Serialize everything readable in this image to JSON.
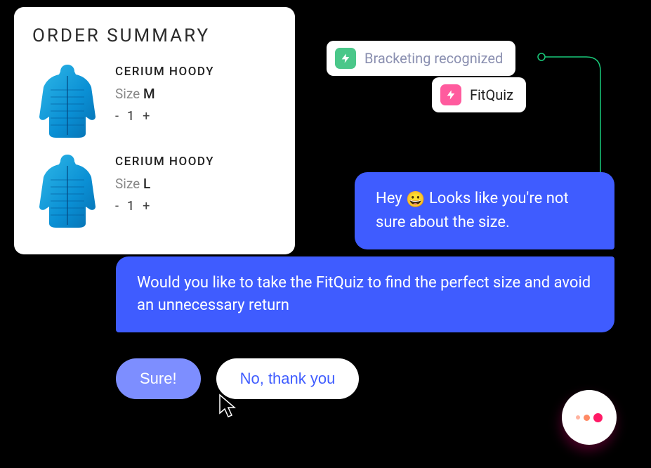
{
  "order": {
    "title": "ORDER SUMMARY",
    "items": [
      {
        "name": "CERIUM HOODY",
        "sizeLabel": "Size ",
        "size": "M",
        "qty": "1"
      },
      {
        "name": "CERIUM HOODY",
        "sizeLabel": "Size ",
        "size": "L",
        "qty": "1"
      }
    ],
    "minus": "-",
    "plus": "+"
  },
  "tags": {
    "bracketing": "Bracketing recognized",
    "fitquiz": "FitQuiz"
  },
  "chat": {
    "msg1_pre": "Hey ",
    "msg1_post": " Looks like you're not sure about the size.",
    "msg2": "Would you like to take the FitQuiz to find the perfect size and avoid an unnecessary return"
  },
  "replies": {
    "sure": "Sure!",
    "no": "No, thank you"
  }
}
